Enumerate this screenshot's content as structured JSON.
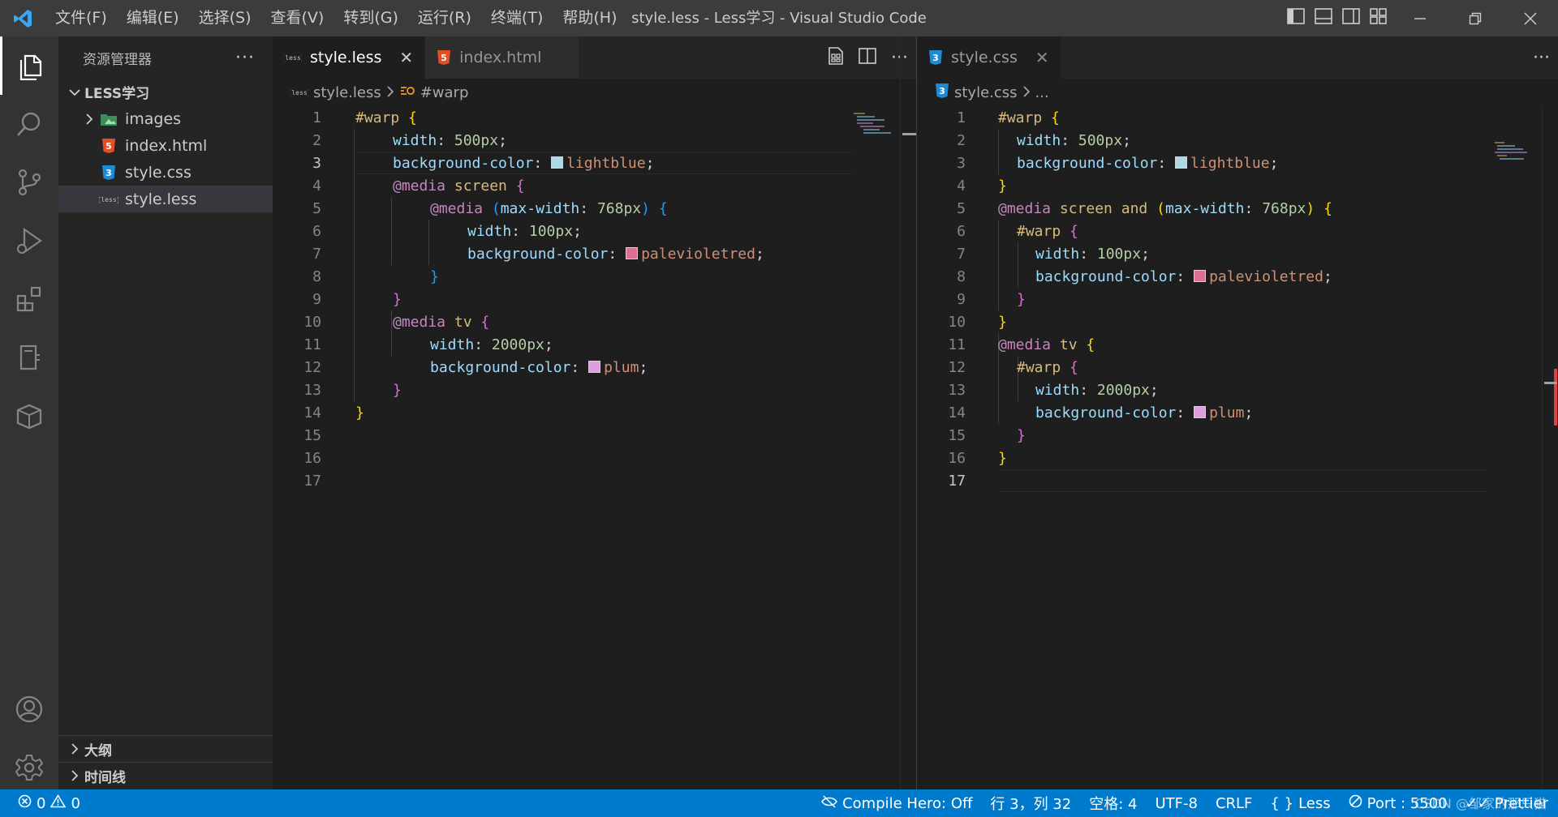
{
  "window": {
    "title": "style.less - Less学习 - Visual Studio Code",
    "menu": [
      "文件(F)",
      "编辑(E)",
      "选择(S)",
      "查看(V)",
      "转到(G)",
      "运行(R)",
      "终端(T)",
      "帮助(H)"
    ]
  },
  "activity_bar": {
    "items": [
      "explorer-icon",
      "search-icon",
      "source-control-icon",
      "run-debug-icon",
      "extensions-icon",
      "remote-icon",
      "package-icon"
    ],
    "bottom": [
      "account-icon",
      "settings-gear-icon"
    ]
  },
  "sidebar": {
    "title": "资源管理器",
    "more": "···",
    "folder": "LESS学习",
    "items": [
      {
        "label": "images",
        "icon": "image-folder-icon"
      },
      {
        "label": "index.html",
        "icon": "html5-icon"
      },
      {
        "label": "style.css",
        "icon": "css3-icon"
      },
      {
        "label": "style.less",
        "icon": "less-icon"
      }
    ],
    "outline": "大纲",
    "timeline": "时间线"
  },
  "left_editor": {
    "tabs": [
      {
        "label": "style.less",
        "icon_text": "{less}",
        "active": true
      },
      {
        "label": "index.html",
        "active": false
      }
    ],
    "breadcrumb": {
      "file": "style.less",
      "icon_text": "{less}",
      "symbol": "#warp"
    },
    "current_line": 3,
    "line_numbers": [
      "1",
      "2",
      "3",
      "4",
      "5",
      "6",
      "7",
      "8",
      "9",
      "10",
      "11",
      "12",
      "13",
      "14",
      "15",
      "16",
      "17"
    ]
  },
  "right_editor": {
    "tabs": [
      {
        "label": "style.css",
        "active": true
      }
    ],
    "breadcrumb": {
      "file": "style.css",
      "symbol": "..."
    },
    "current_line": 17,
    "line_numbers": [
      "1",
      "2",
      "3",
      "4",
      "5",
      "6",
      "7",
      "8",
      "9",
      "10",
      "11",
      "12",
      "13",
      "14",
      "15",
      "16",
      "17"
    ]
  },
  "colors": {
    "lightblue": "#add8e6",
    "palevioletred": "#db7093",
    "plum": "#dda0dd",
    "statusbar": "#007acc"
  },
  "code": {
    "warp": "#warp",
    "brace_open": "{",
    "brace_close": "}",
    "width": "width",
    "colon": ":",
    "semi": ";",
    "bg": "background-color",
    "px500": "500px",
    "px100": "100px",
    "px2000": "2000px",
    "px768": "768px",
    "lightblue": "lightblue",
    "palevioletred": "palevioletred",
    "plum": "plum",
    "media": "@media",
    "screen": "screen",
    "tv": "tv",
    "and": "and",
    "maxwidth": "max-width",
    "paren_open": "(",
    "paren_close": ")"
  },
  "status_bar": {
    "errors": "0",
    "warnings": "0",
    "compile_hero": "Compile Hero: Off",
    "position": "行 3，列 32",
    "spaces": "空格: 4",
    "encoding": "UTF-8",
    "eol": "CRLF",
    "language": "Less",
    "port": "Port : 5500",
    "prettier": "Prettier",
    "watermark": "CSDN @邹家的那只猫"
  }
}
